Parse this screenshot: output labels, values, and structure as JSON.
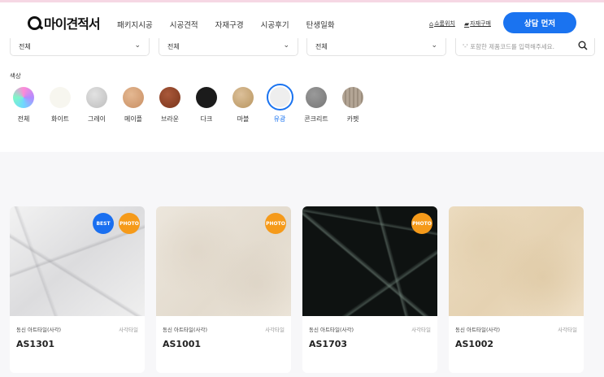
{
  "header": {
    "logo_text": "마이견적서",
    "nav": [
      "패키지시공",
      "시공견적",
      "자재구경",
      "시공후기",
      "탄생일화"
    ],
    "util_shop": "쇼룸위치",
    "util_buy": "자재구매",
    "consult_button": "상담 먼저"
  },
  "filters": {
    "select1": "전체",
    "select2": "전체",
    "select3": "전체",
    "search_placeholder": "'-' 포함한 제품코드를 입력해주세요."
  },
  "color_section": {
    "label": "색상",
    "colors": [
      {
        "label": "전체",
        "color": "conic-rainbow"
      },
      {
        "label": "화이트",
        "color": "#f7f6ef"
      },
      {
        "label": "그레이",
        "color": "#cfcfcf"
      },
      {
        "label": "메이플",
        "color": "#d6a47a"
      },
      {
        "label": "브라운",
        "color": "#8b4325"
      },
      {
        "label": "다크",
        "color": "#1b1b1b"
      },
      {
        "label": "마블",
        "color": "#c8a878"
      },
      {
        "label": "유광",
        "color": "#eeeeee",
        "selected": true
      },
      {
        "label": "콘크리트",
        "color": "#8a8a8a"
      },
      {
        "label": "카펫",
        "color": "#a89a8a"
      }
    ]
  },
  "products": [
    {
      "brand": "동신 아트타일(사각)",
      "type": "사각타일",
      "code": "AS1301",
      "badges": [
        "BEST",
        "PHOTO"
      ]
    },
    {
      "brand": "동신 아트타일(사각)",
      "type": "사각타일",
      "code": "AS1001",
      "badges": [
        "PHOTO"
      ]
    },
    {
      "brand": "동신 아트타일(사각)",
      "type": "사각타일",
      "code": "AS1703",
      "badges": [
        "PHOTO"
      ]
    },
    {
      "brand": "동신 아트타일(사각)",
      "type": "사각타일",
      "code": "AS1002",
      "badges": []
    }
  ],
  "accent_color": "#1a73f0",
  "photo_badge_color": "#f59a1a"
}
